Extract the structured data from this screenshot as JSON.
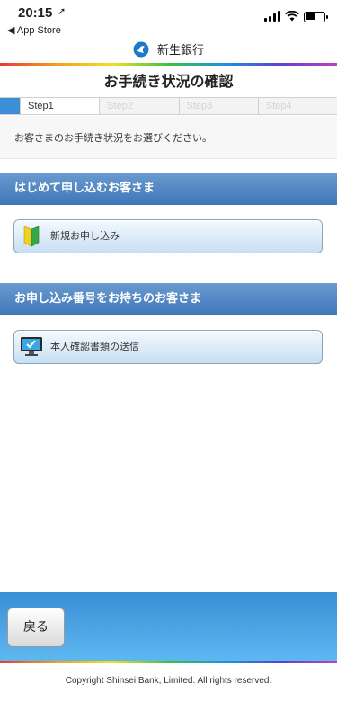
{
  "status_bar": {
    "time": "20:15",
    "back_label": "◀ App Store",
    "battery_level": 0.6
  },
  "brand": {
    "name": "新生銀行"
  },
  "page_title": "お手続き状況の確認",
  "steps": [
    {
      "label": "Step1",
      "active": true
    },
    {
      "label": "Step2",
      "active": false
    },
    {
      "label": "Step3",
      "active": false
    },
    {
      "label": "Step4",
      "active": false
    }
  ],
  "instruction": "お客さまのお手続き状況をお選びください。",
  "sections": [
    {
      "title": "はじめて申し込むお客さま",
      "button_label": "新規お申し込み",
      "icon": "beginner-mark-icon"
    },
    {
      "title": "お申し込み番号をお持ちのお客さま",
      "button_label": "本人確認書類の送信",
      "icon": "monitor-icon"
    }
  ],
  "back_button": "戻る",
  "copyright": "Copyright Shinsei Bank, Limited. All rights reserved.",
  "colors": {
    "header_blue": "#3f77b8",
    "footer_blue": "#3a8fd6"
  }
}
